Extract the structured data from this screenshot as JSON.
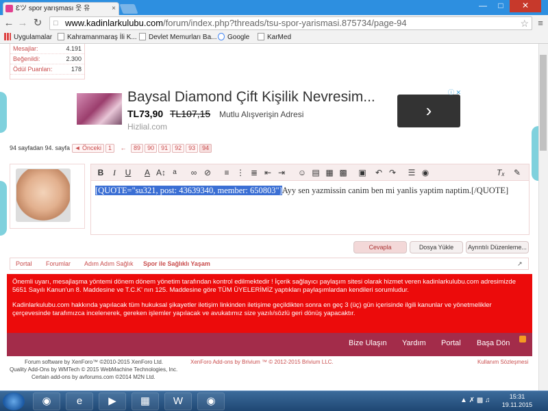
{
  "browser": {
    "tab_title": "Ɛツ spor yarışması 웃 유",
    "tab_close": "×",
    "url_domain": "www.kadinlarkulubu.com",
    "url_path": "/forum/index.php?threads/tsu-spor-yarismasi.875734/page-94",
    "bookmarks": [
      "Uygulamalar",
      "Kahramanmaraş İli K...",
      "Devlet Memurları Ba...",
      "Google",
      "KarMed"
    ]
  },
  "stats": [
    {
      "label": "Mesajlar:",
      "value": "4.191"
    },
    {
      "label": "Beğenildi:",
      "value": "2.300"
    },
    {
      "label": "Ödül Puanları:",
      "value": "178"
    }
  ],
  "ad": {
    "title": "Baysal Diamond Çift Kişilik Nevresim...",
    "price": "TL73,90",
    "old_price": "TL107,15",
    "tagline": "Mutlu Alışverişin Adresi",
    "site": "Hizlial.com",
    "arrow": "›",
    "info": "ⓘ ✕"
  },
  "pager": {
    "summary": "94 sayfadan 94. sayfa",
    "prev": "◄ Önceki",
    "first": "1",
    "gap": "←",
    "pages": [
      "89",
      "90",
      "91",
      "92",
      "93",
      "94"
    ]
  },
  "editor": {
    "quote_selected": "[QUOTE=\"su321, post: 43639340, member: 650803\"]",
    "quote_rest": "Ayy sen yazmissin canim ben mi yanlis yaptim naptim.[/QUOTE]",
    "reply_label": "Cevapla",
    "upload_label": "Dosya Yükle",
    "advanced_label": "Ayrıntılı Düzenleme..."
  },
  "breadcrumbs": [
    "Portal",
    "Forumlar",
    "Adım Adım Sağlık",
    "Spor ile Sağlıklı Yaşam"
  ],
  "notice": {
    "p1": "Önemli uyarı, mesajlaşma yöntemi dönem dönem yönetim tarafından kontrol edilmektedir ! İçerik sağlayıcı paylaşım sitesi olarak hizmet veren kadinlarkulubu.com adresimizde 5651 Sayılı Kanun'un 8. Maddesine ve T.C.K' nın 125. Maddesine göre TÜM ÜYELERİMİZ yaptıkları paylaşımlardan kendileri sorumludur.",
    "p2": "Kadinlarkulubu.com hakkında yapılacak tüm hukuksal şikayetler iletişim linkinden iletişime geçildikten sonra en geç 3 (üç) gün içerisinde ilgili kanunlar ve yönetmelikler çerçevesinde tarafımızca incelenerek, gereken işlemler yapılacak ve avukatımız size yazılı/sözlü geri dönüş yapacaktır."
  },
  "footer_nav": [
    "Bize Ulaşın",
    "Yardım",
    "Portal",
    "Başa Dön"
  ],
  "footer": {
    "software": "Forum software by XenForo™ ©2010-2015 XenForo Ltd.",
    "quality": "Quality Add-Ons by WMTech © 2015 WebMachine Technologies, Inc.",
    "certain": "Certain add-ons by avforums.com ©2014 M2N Ltd.",
    "brivium": "XenForo Add-ons by Brivium ™ © 2012-2015 Brivium LLC.",
    "terms": "Kullanım Sözleşmesi"
  },
  "taskbar": {
    "time": "15:31",
    "date": "19.11.2015"
  }
}
